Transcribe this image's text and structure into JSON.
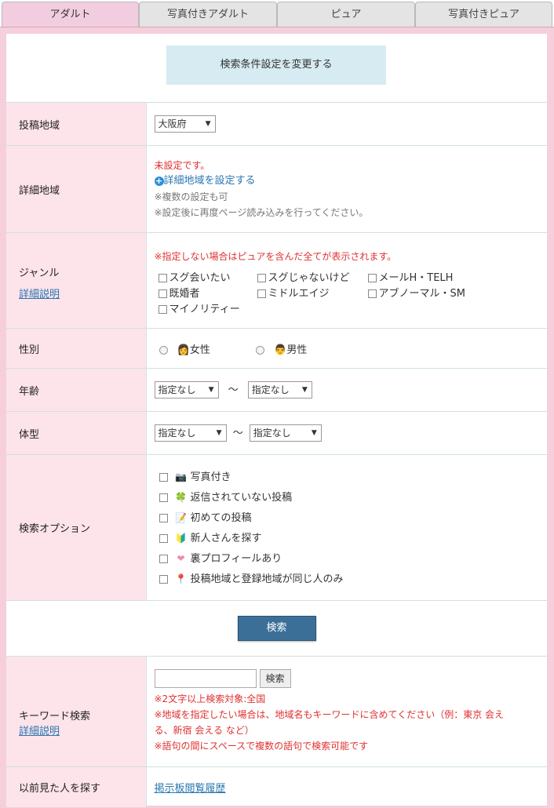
{
  "tabs": [
    {
      "label": "アダルト",
      "active": true
    },
    {
      "label": "写真付きアダルト",
      "active": false
    },
    {
      "label": "ピュア",
      "active": false
    },
    {
      "label": "写真付きピュア",
      "active": false
    }
  ],
  "change_conditions_label": "検索条件設定を変更する",
  "region": {
    "label": "投稿地域",
    "value": "大阪府"
  },
  "detail_region": {
    "label": "詳細地域",
    "status": "未設定です。",
    "set_link": "詳細地域を設定する",
    "note1": "※複数の設定も可",
    "note2": "※設定後に再度ページ読み込みを行ってください。"
  },
  "genre": {
    "label": "ジャンル",
    "detail_link": "詳細説明",
    "note": "※指定しない場合はピュアを含んだ全てが表示されます。",
    "options": [
      "スグ会いたい",
      "スグじゃないけど",
      "メールH・TELH",
      "既婚者",
      "ミドルエイジ",
      "アブノーマル・SM",
      "マイノリティー"
    ]
  },
  "gender": {
    "label": "性別",
    "female": "女性",
    "male": "男性"
  },
  "age": {
    "label": "年齢",
    "from": "指定なし",
    "to": "指定なし",
    "sep": "～"
  },
  "body_type": {
    "label": "体型",
    "from": "指定なし",
    "to": "指定なし",
    "sep": "～"
  },
  "search_options": {
    "label": "検索オプション",
    "items": [
      {
        "label": "写真付き",
        "icon": "camera-icon",
        "glyph": "📷"
      },
      {
        "label": "返信されていない投稿",
        "icon": "clover-icon",
        "glyph": "🍀"
      },
      {
        "label": "初めての投稿",
        "icon": "memo-icon",
        "glyph": "📝"
      },
      {
        "label": "新人さんを探す",
        "icon": "beginner-mark-icon",
        "glyph": "🔰"
      },
      {
        "label": "裏プロフィールあり",
        "icon": "heart-icon",
        "glyph": "❤"
      },
      {
        "label": "投稿地域と登録地域が同じ人のみ",
        "icon": "pin-icon",
        "glyph": "📍"
      }
    ]
  },
  "search_button": "検索",
  "keyword": {
    "label": "キーワード検索",
    "detail_link": "詳細説明",
    "button": "検索",
    "note1": "※2文字以上検索対象:全国",
    "note2a": "※地域を指定したい場合は、地域名もキーワードに含めてください（例：東京 会え",
    "note2b": "る、新宿 会える など）",
    "note3": "※語句の間にスペースで複数の語句で検索可能です"
  },
  "history": {
    "label": "以前見た人を探す",
    "link": "掲示板閲覧履歴"
  },
  "colors": {
    "tab_active": "#f2cde0",
    "label_bg": "#fde4ea",
    "accent": "#3c6f97",
    "warning": "#e03030"
  }
}
